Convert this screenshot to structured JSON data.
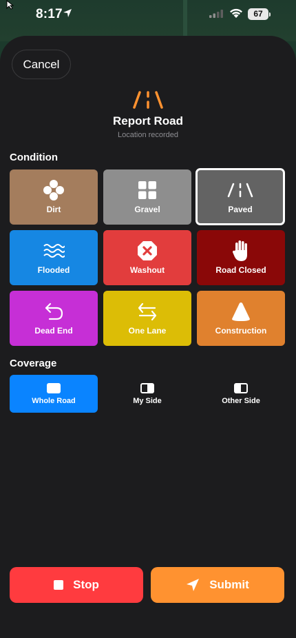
{
  "status_bar": {
    "time": "8:17",
    "battery": "67"
  },
  "header": {
    "cancel_label": "Cancel",
    "title": "Report Road",
    "subtitle": "Location recorded",
    "icon": "road-icon"
  },
  "condition": {
    "label": "Condition",
    "selected": "Paved",
    "tiles": [
      {
        "label": "Dirt",
        "color": "#a47d5d",
        "icon": "dirt-icon"
      },
      {
        "label": "Gravel",
        "color": "#8e8e8e",
        "icon": "gravel-grid-icon"
      },
      {
        "label": "Paved",
        "color": "#636363",
        "icon": "road-icon"
      },
      {
        "label": "Flooded",
        "color": "#1687e3",
        "icon": "water-waves-icon"
      },
      {
        "label": "Washout",
        "color": "#e23d3d",
        "icon": "x-octagon-icon"
      },
      {
        "label": "Road Closed",
        "color": "#8a0808",
        "icon": "hand-stop-icon"
      },
      {
        "label": "Dead End",
        "color": "#c62fd6",
        "icon": "u-turn-arrow-icon"
      },
      {
        "label": "One Lane",
        "color": "#dcbd06",
        "icon": "two-way-arrows-icon"
      },
      {
        "label": "Construction",
        "color": "#e0812e",
        "icon": "cone-icon"
      }
    ]
  },
  "coverage": {
    "label": "Coverage",
    "selected": "Whole Road",
    "options": [
      {
        "label": "Whole Road",
        "icon": "whole-road-icon"
      },
      {
        "label": "My Side",
        "icon": "my-side-icon"
      },
      {
        "label": "Other Side",
        "icon": "other-side-icon"
      }
    ],
    "selected_color": "#0a84ff"
  },
  "actions": {
    "stop_label": "Stop",
    "stop_color": "#ff3b3f",
    "submit_label": "Submit",
    "submit_color": "#ff9230"
  }
}
